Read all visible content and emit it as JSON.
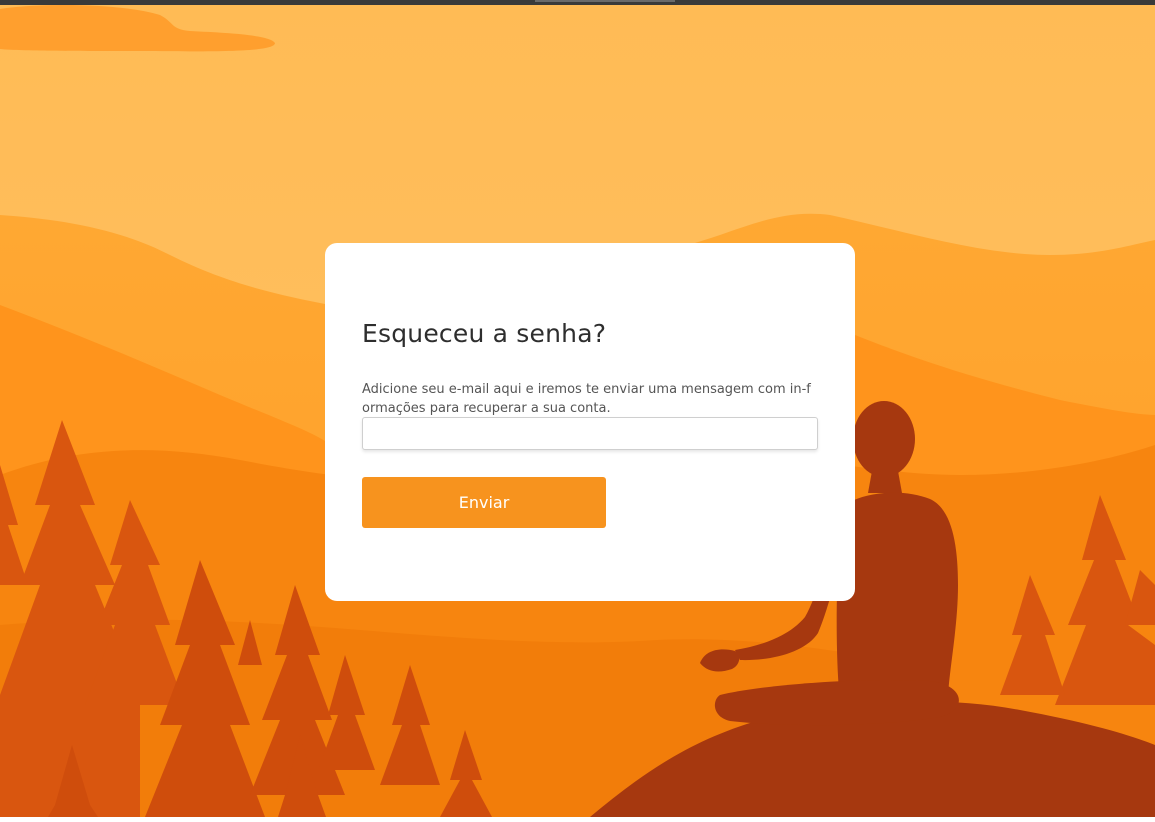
{
  "theme": {
    "accent": "#f7931e",
    "sky": "#ffbb55",
    "card_background": "#ffffff",
    "silhouette": "#a6380f"
  },
  "recovery": {
    "title": "Esqueceu a senha?",
    "description": "Adicione seu e-mail aqui e iremos te enviar uma mensagem com in-formações para recuperar a sua conta.",
    "email_value": "",
    "email_placeholder": "",
    "submit_label": "Enviar"
  }
}
